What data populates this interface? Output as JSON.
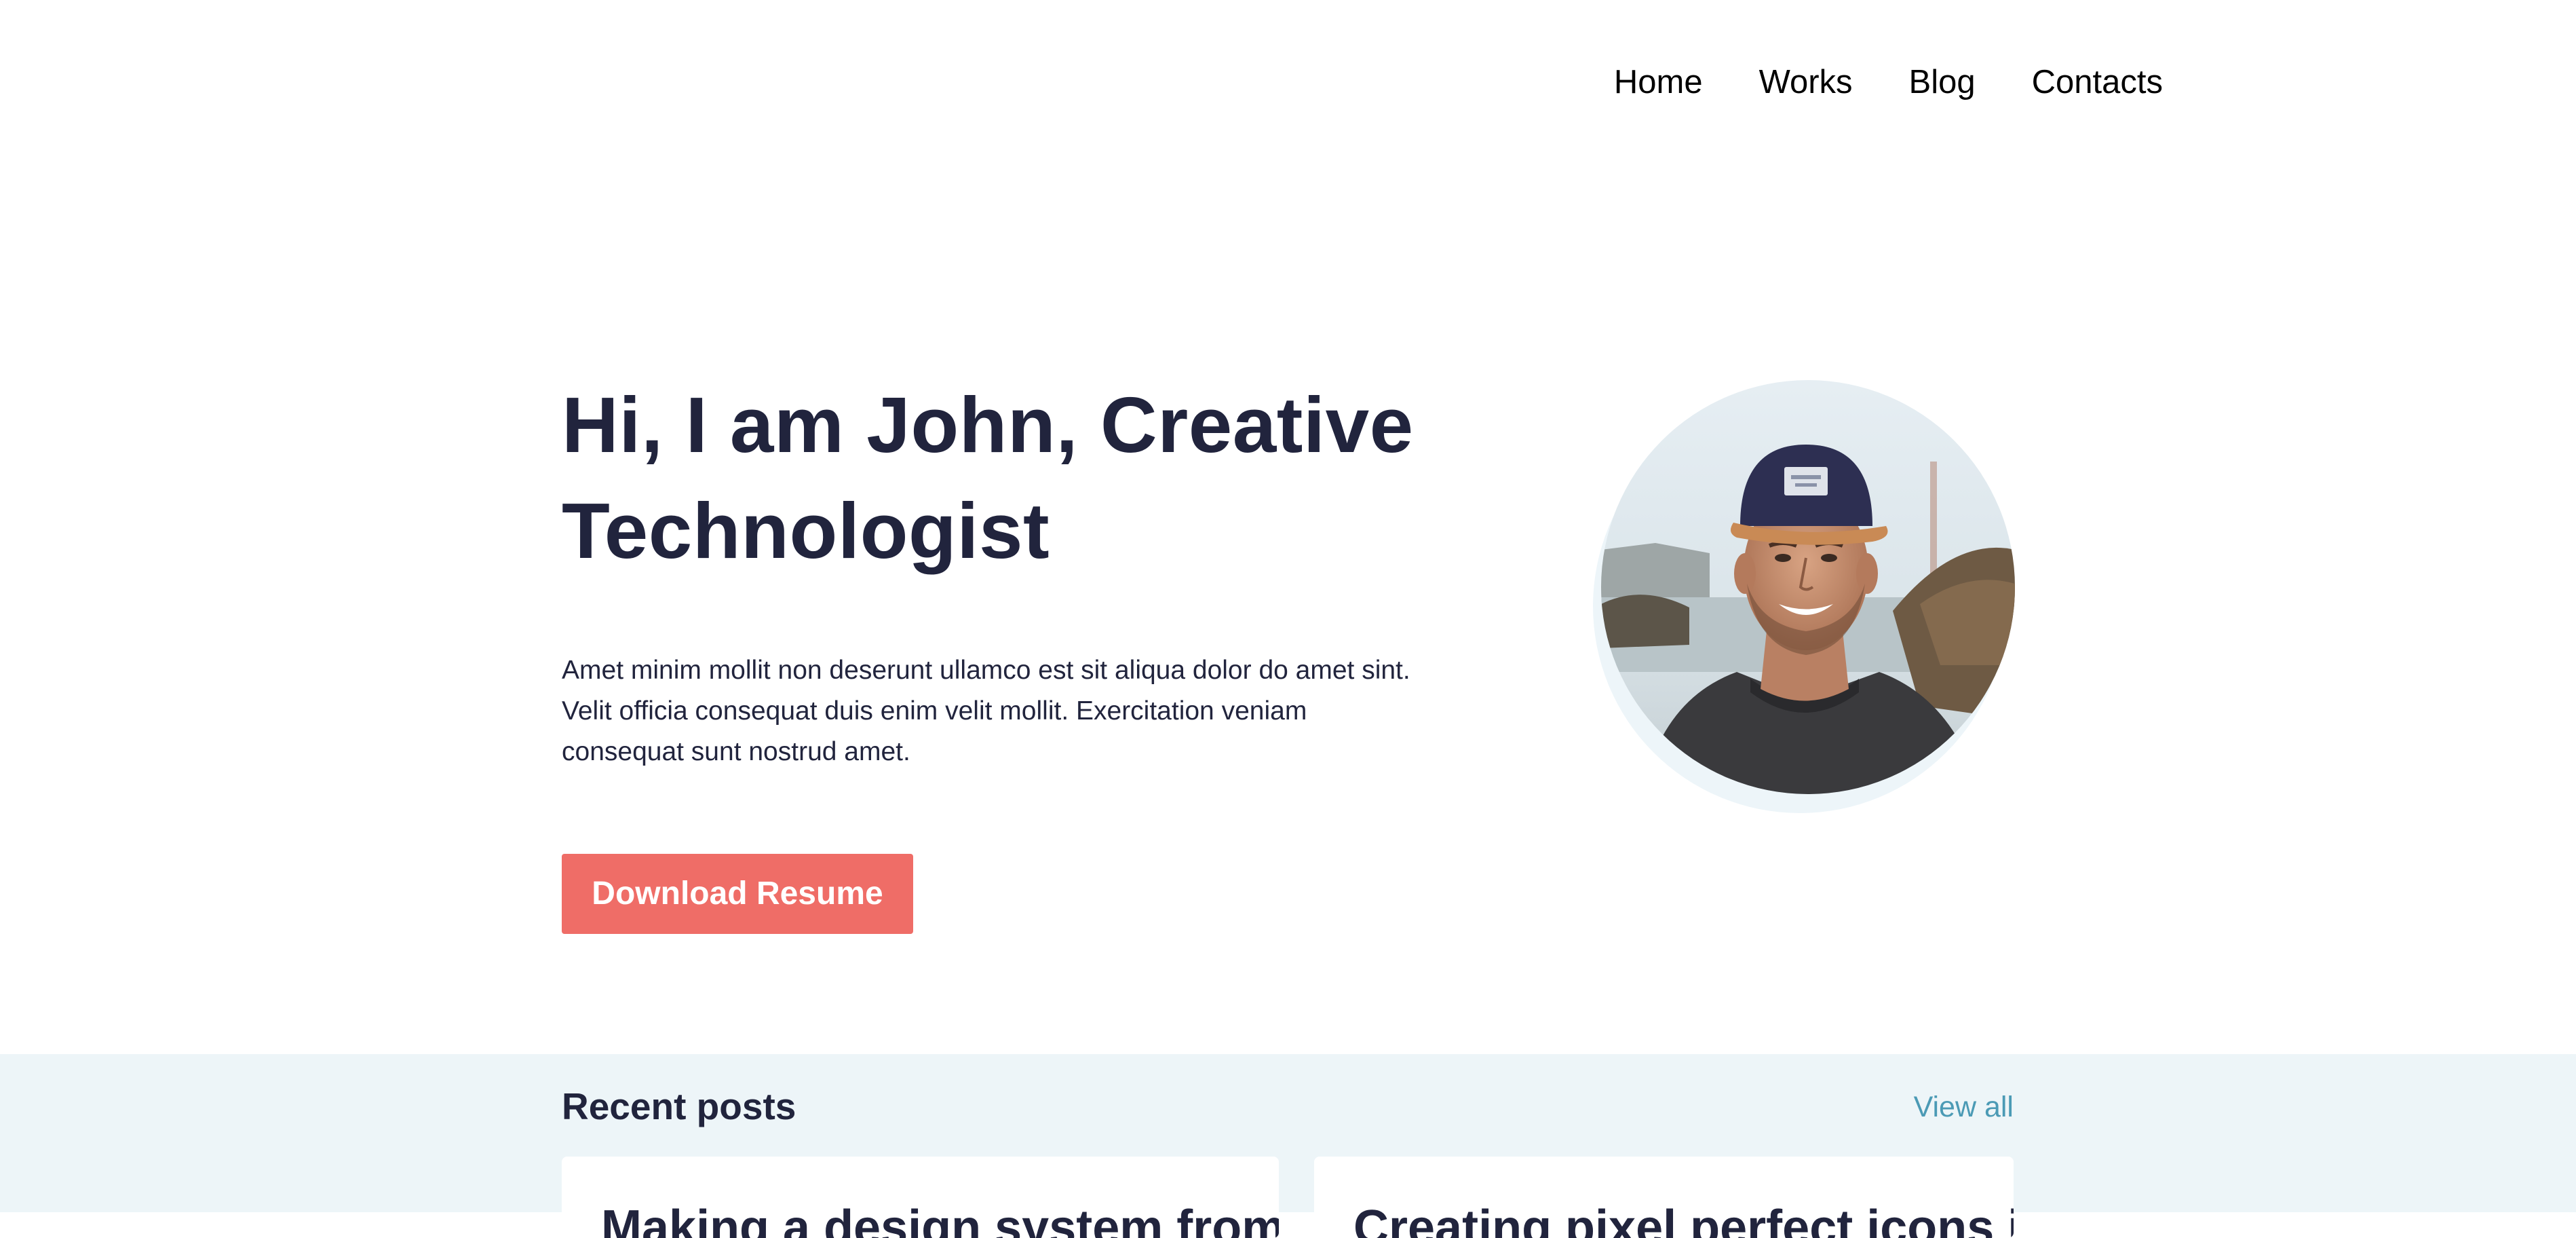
{
  "nav": {
    "items": [
      {
        "label": "Home"
      },
      {
        "label": "Works"
      },
      {
        "label": "Blog"
      },
      {
        "label": "Contacts"
      }
    ]
  },
  "hero": {
    "title_line1": "Hi, I am John, Creative",
    "title_line2": "Technologist",
    "description": "Amet minim mollit non deserunt ullamco est sit aliqua dolor do amet sint. Velit officia consequat duis enim velit mollit. Exercitation veniam consequat sunt nostrud amet.",
    "button_label": "Download Resume",
    "button_color": "#ef6d67"
  },
  "recent_posts": {
    "title": "Recent posts",
    "view_all_label": "View all",
    "link_color": "#4b9ab5",
    "posts": [
      {
        "title": "Making a design system from"
      },
      {
        "title": "Creating pixel perfect icons in"
      }
    ]
  },
  "colors": {
    "text_dark": "#21243d",
    "section_bg": "#edf5f8"
  }
}
